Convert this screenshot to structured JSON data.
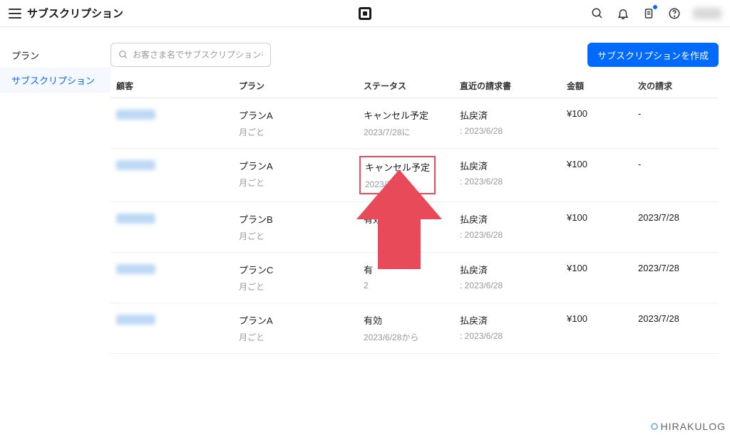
{
  "header": {
    "title": "サブスクリプション"
  },
  "sidebar": {
    "items": [
      {
        "label": "プラン",
        "active": false
      },
      {
        "label": "サブスクリプション",
        "active": true
      }
    ]
  },
  "toolbar": {
    "search_placeholder": "お客さま名でサブスクリプションを検索",
    "create_label": "サブスクリプションを作成"
  },
  "table": {
    "headers": {
      "customer": "顧客",
      "plan": "プラン",
      "status": "ステータス",
      "invoice": "直近の請求書",
      "amount": "金額",
      "next": "次の請求"
    },
    "rows": [
      {
        "plan": "プランA",
        "plan_sub": "月ごと",
        "status": "キャンセル予定",
        "status_sub": "2023/7/28に",
        "invoice": "払戻済",
        "invoice_sub": ": 2023/6/28",
        "amount": "¥100",
        "next": "-"
      },
      {
        "plan": "プランA",
        "plan_sub": "月ごと",
        "status": "キャンセル予定",
        "status_sub": "2023/7/28に",
        "invoice": "払戻済",
        "invoice_sub": ": 2023/6/28",
        "amount": "¥100",
        "next": "-"
      },
      {
        "plan": "プランB",
        "plan_sub": "月ごと",
        "status": "有効",
        "status_sub": "",
        "invoice": "払戻済",
        "invoice_sub": ": 2023/6/28",
        "amount": "¥100",
        "next": "2023/7/28"
      },
      {
        "plan": "プランC",
        "plan_sub": "月ごと",
        "status": "有",
        "status_sub": "2",
        "invoice": "払戻済",
        "invoice_sub": ": 2023/6/28",
        "amount": "¥100",
        "next": "2023/7/28"
      },
      {
        "plan": "プランA",
        "plan_sub": "月ごと",
        "status": "有効",
        "status_sub": "2023/6/28から",
        "invoice": "払戻済",
        "invoice_sub": ": 2023/6/28",
        "amount": "¥100",
        "next": "2023/7/28"
      }
    ]
  },
  "watermark": "HIRAKULOG"
}
